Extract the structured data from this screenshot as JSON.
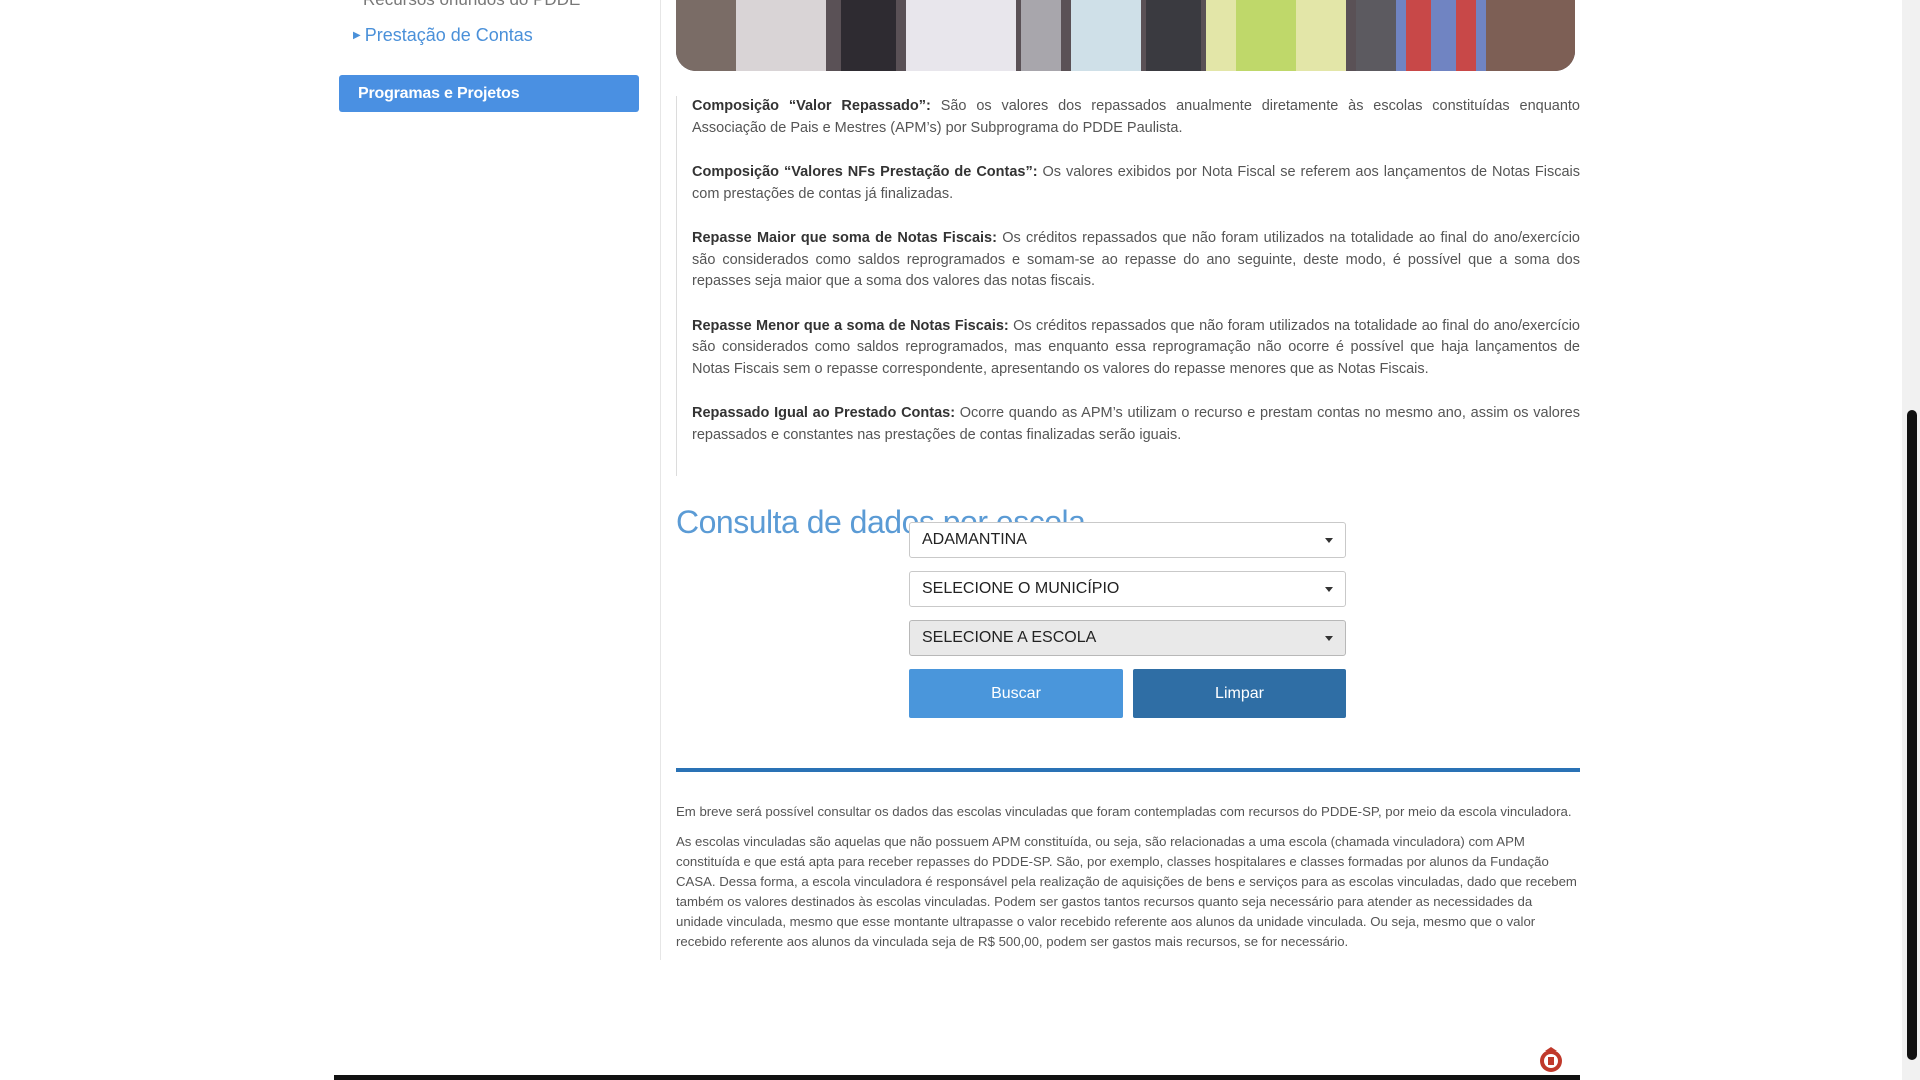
{
  "sidebar": {
    "link_top": "Recursos oriundos do PDDE",
    "link_prestacao": "Prestação de Contas",
    "button_programas": "Programas e Projetos"
  },
  "definitions": [
    {
      "term": "Composição “Valor Repassado”:",
      "text": " São os valores dos repassados anualmente diretamente às escolas constituídas enquanto Associação de Pais e Mestres (APM’s) por Subprograma do PDDE Paulista."
    },
    {
      "term": "Composição “Valores NFs Prestação de Contas”:",
      "text": " Os valores exibidos por Nota Fiscal se referem aos lançamentos de Notas Fiscais com prestações de contas já finalizadas."
    },
    {
      "term": "Repasse Maior que soma de Notas Fiscais:",
      "text": " Os créditos repassados que não foram utilizados na totalidade ao final do ano/exercício são considerados como saldos reprogramados e somam-se ao repasse do ano seguinte, deste modo, é possível que a soma dos repasses seja maior que a soma dos valores das notas fiscais."
    },
    {
      "term": "Repasse Menor que a soma de Notas Fiscais:",
      "text": " Os créditos repassados que não foram utilizados na totalidade ao final do ano/exercício são considerados como saldos reprogramados, mas enquanto essa reprogramação não ocorre é possível que haja lançamentos de Notas Fiscais sem o repasse correspondente, apresentando os valores do repasse menores que as Notas Fiscais."
    },
    {
      "term": "Repassado Igual ao Prestado Contas:",
      "text": " Ocorre quando as APM’s utilizam o recurso e prestam contas no mesmo ano, assim os valores repassados e constantes nas prestações de contas finalizadas serão iguais."
    }
  ],
  "query": {
    "title": "Consulta de dados por escola",
    "diretoria_value": "ADAMANTINA",
    "municipio_value": "SELECIONE O MUNICÍPIO",
    "escola_value": "SELECIONE A ESCOLA",
    "buscar_label": "Buscar",
    "limpar_label": "Limpar"
  },
  "notes": {
    "note1": "Em breve será possível consultar os dados das escolas vinculadas que foram contempladas com recursos do PDDE-SP, por meio da escola vinculadora.",
    "note2": "As escolas vinculadas são aquelas que não possuem APM constituída, ou seja, são relacionadas a uma escola (chamada vinculadora) com APM constituída e que está apta para receber repasses do PDDE-SP. São, por exemplo, classes hospitalares e classes formadas por alunos da Fundação CASA. Dessa forma, a escola vinculadora é responsável pela realização de aquisições de bens e serviços para as escolas vinculadas, dado que recebem também os valores destinados às escolas vinculadas. Podem ser gastos tantos recursos quanto seja necessário para atender as necessidades da unidade vinculada, mesmo que esse montante ultrapasse o valor recebido referente aos alunos da unidade vinculada. Ou seja, mesmo que o valor recebido referente aos alunos da vinculada seja de R$ 500,00, podem ser gastos mais recursos, se for necessário."
  },
  "colors": {
    "accent": "#4a90e2",
    "title_blue": "#5b9bd5",
    "button_dark": "#2f6ea5",
    "rule_blue": "#2a72b5"
  }
}
